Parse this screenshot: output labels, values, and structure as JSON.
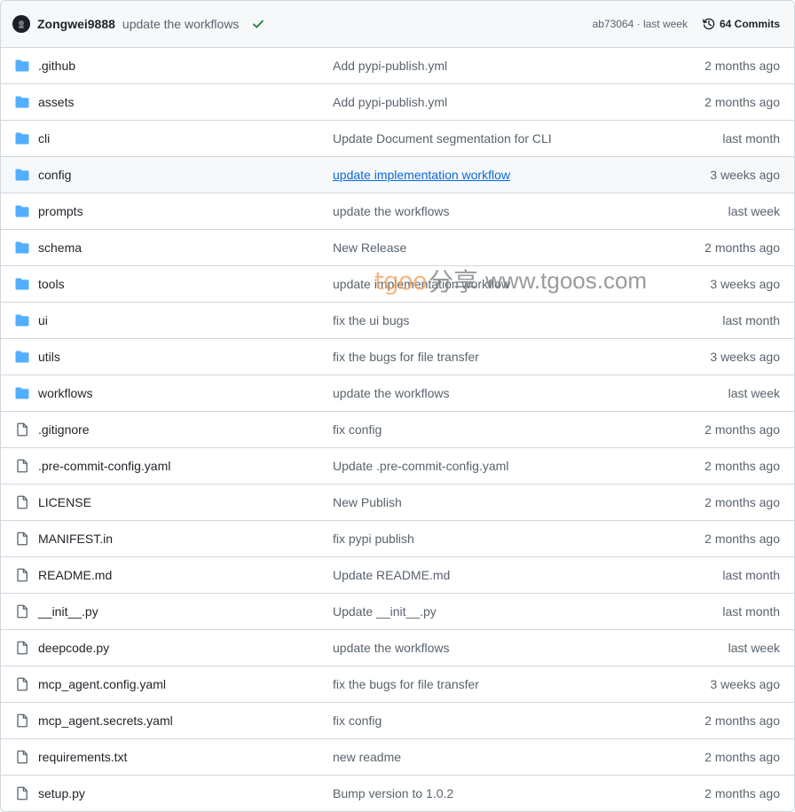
{
  "header": {
    "author": "Zongwei9888",
    "message": "update the workflows",
    "status": "success",
    "hash_date": "ab73064 · last week",
    "commits_label": "64 Commits"
  },
  "files": [
    {
      "type": "folder",
      "name": ".github",
      "message": "Add pypi-publish.yml",
      "date": "2 months ago"
    },
    {
      "type": "folder",
      "name": "assets",
      "message": "Add pypi-publish.yml",
      "date": "2 months ago"
    },
    {
      "type": "folder",
      "name": "cli",
      "message": "Update Document segmentation for CLI",
      "date": "last month"
    },
    {
      "type": "folder",
      "name": "config",
      "message": "update implementation workflow",
      "date": "3 weeks ago"
    },
    {
      "type": "folder",
      "name": "prompts",
      "message": "update the workflows",
      "date": "last week"
    },
    {
      "type": "folder",
      "name": "schema",
      "message": "New Release",
      "date": "2 months ago"
    },
    {
      "type": "folder",
      "name": "tools",
      "message": "update implementation workflow",
      "date": "3 weeks ago"
    },
    {
      "type": "folder",
      "name": "ui",
      "message": "fix the ui bugs",
      "date": "last month"
    },
    {
      "type": "folder",
      "name": "utils",
      "message": "fix the bugs for file transfer",
      "date": "3 weeks ago"
    },
    {
      "type": "folder",
      "name": "workflows",
      "message": "update the workflows",
      "date": "last week"
    },
    {
      "type": "file",
      "name": ".gitignore",
      "message": "fix config",
      "date": "2 months ago"
    },
    {
      "type": "file",
      "name": ".pre-commit-config.yaml",
      "message": "Update .pre-commit-config.yaml",
      "date": "2 months ago"
    },
    {
      "type": "file",
      "name": "LICENSE",
      "message": "New Publish",
      "date": "2 months ago"
    },
    {
      "type": "file",
      "name": "MANIFEST.in",
      "message": "fix pypi publish",
      "date": "2 months ago"
    },
    {
      "type": "file",
      "name": "README.md",
      "message": "Update README.md",
      "date": "last month"
    },
    {
      "type": "file",
      "name": "__init__.py",
      "message": "Update __init__.py",
      "date": "last month"
    },
    {
      "type": "file",
      "name": "deepcode.py",
      "message": "update the workflows",
      "date": "last week"
    },
    {
      "type": "file",
      "name": "mcp_agent.config.yaml",
      "message": "fix the bugs for file transfer",
      "date": "3 weeks ago"
    },
    {
      "type": "file",
      "name": "mcp_agent.secrets.yaml",
      "message": "fix config",
      "date": "2 months ago"
    },
    {
      "type": "file",
      "name": "requirements.txt",
      "message": "new readme",
      "date": "2 months ago"
    },
    {
      "type": "file",
      "name": "setup.py",
      "message": "Bump version to 1.0.2",
      "date": "2 months ago"
    }
  ],
  "hovered_row": "config",
  "watermark": {
    "brand": "tgoo",
    "cn": "分享",
    "url": "www.tgoos.com"
  },
  "colors": {
    "folder": "#54aeff",
    "link": "#0969da",
    "success": "#1a7f37",
    "muted": "#59636e",
    "border": "#d0d7de"
  }
}
